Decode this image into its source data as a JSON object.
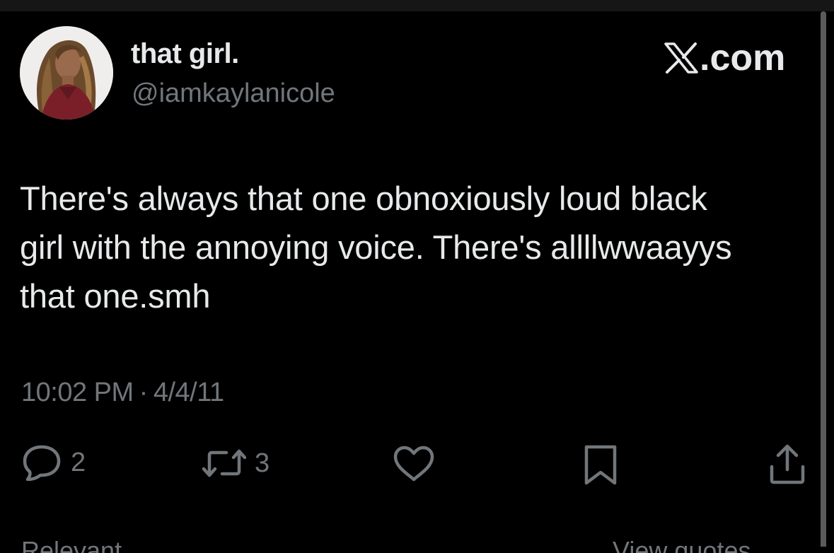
{
  "tweet": {
    "display_name": "that girl.",
    "handle": "@iamkaylanicole",
    "brand": ".com",
    "text_lines": [
      "There's always that one obnoxiously loud black",
      "girl with the annoying voice. There's allllwwaayys",
      "that one.smh"
    ],
    "time": "10:02 PM",
    "separator": "·",
    "date": "4/4/11"
  },
  "actions": {
    "reply_count": "2",
    "retweet_count": "3",
    "reply_icon": "speech-bubble",
    "retweet_icon": "retweet-arrows",
    "like_icon": "heart-outline",
    "bookmark_icon": "bookmark-outline",
    "share_icon": "share-upload"
  },
  "footer": {
    "left_label": "Relevant",
    "right_label": "View quotes"
  },
  "colors": {
    "background": "#000000",
    "primary_text": "#e7e9ea",
    "secondary_text": "#71767b",
    "scrollbar": "#5b5b5b"
  }
}
